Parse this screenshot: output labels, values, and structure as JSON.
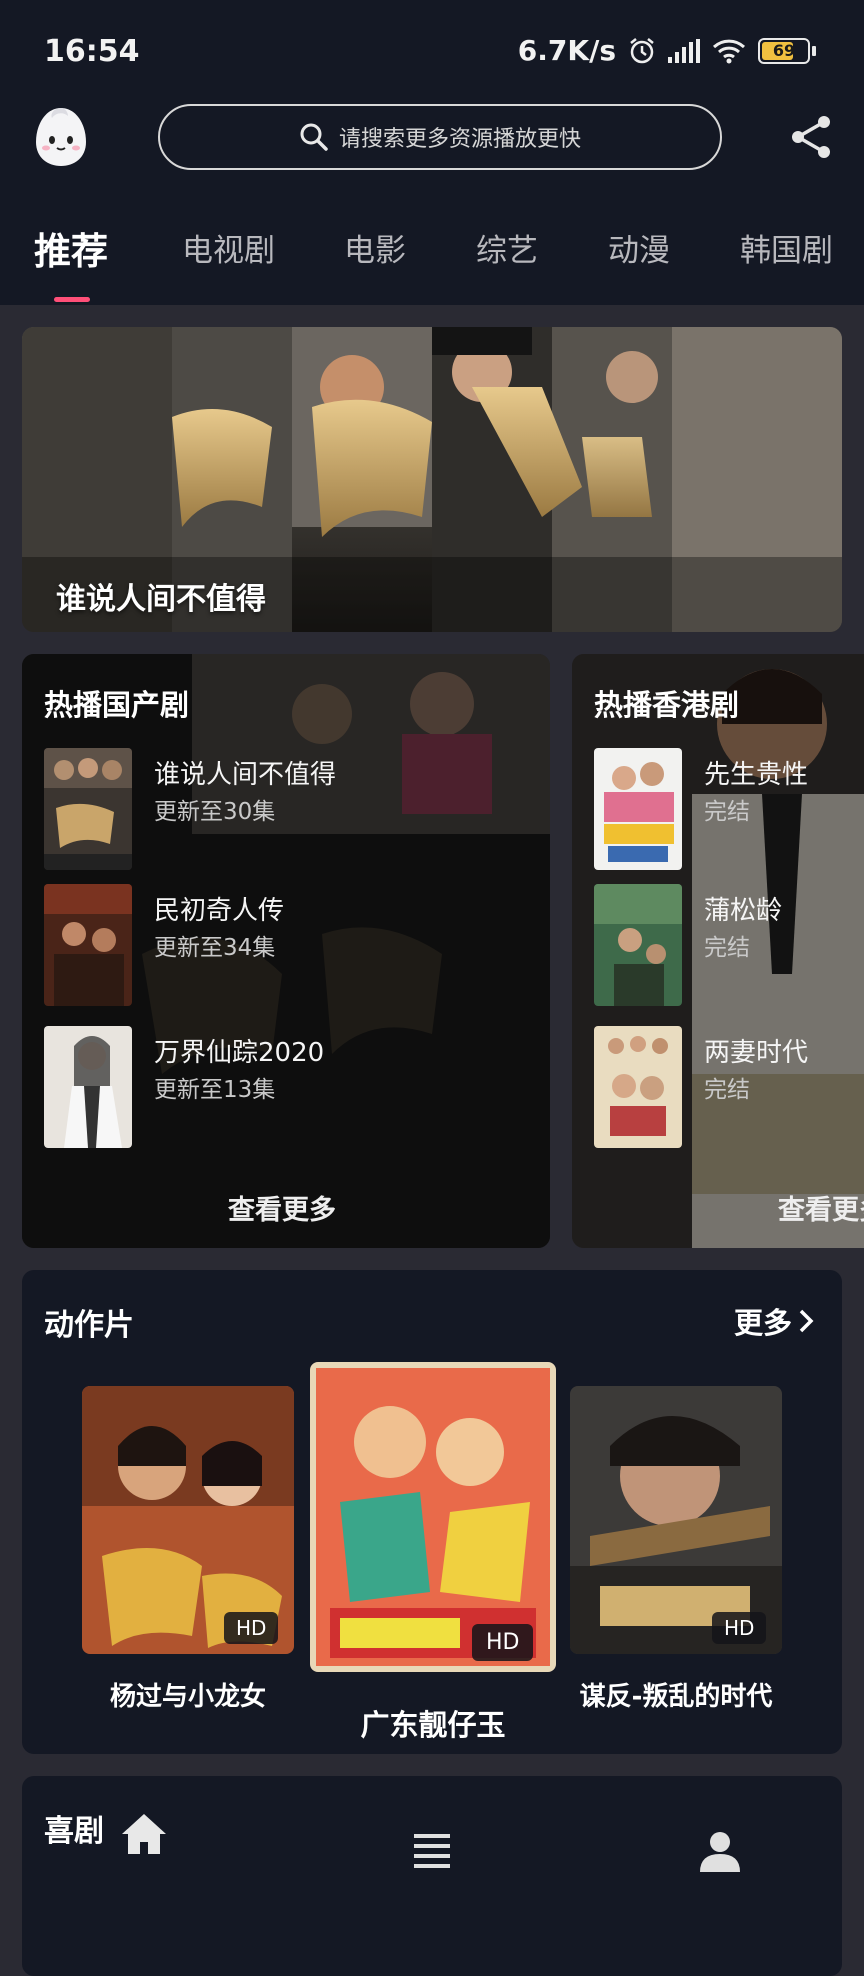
{
  "status": {
    "time": "16:54",
    "speed": "6.7K/s",
    "battery": "69"
  },
  "header": {
    "search_placeholder": "请搜索更多资源播放更快"
  },
  "tabs": [
    "推荐",
    "电视剧",
    "电影",
    "综艺",
    "动漫",
    "韩国剧"
  ],
  "banner": {
    "title": "谁说人间不值得"
  },
  "hot_domestic": {
    "title": "热播国产剧",
    "items": [
      {
        "name": "谁说人间不值得",
        "sub": "更新至30集"
      },
      {
        "name": "民初奇人传",
        "sub": "更新至34集"
      },
      {
        "name": "万界仙踪2020",
        "sub": "更新至13集"
      }
    ],
    "more": "查看更多"
  },
  "hot_hk": {
    "title": "热播香港剧",
    "items": [
      {
        "name": "先生贵性",
        "sub": "完结"
      },
      {
        "name": "蒲松龄",
        "sub": "完结"
      },
      {
        "name": "两妻时代",
        "sub": "完结"
      }
    ],
    "more": "查看更多"
  },
  "action": {
    "title": "动作片",
    "more": "更多",
    "movies": [
      {
        "name": "杨过与小龙女",
        "badge": "HD"
      },
      {
        "name": "广东靓仔玉",
        "badge": "HD"
      },
      {
        "name": "谋反-叛乱的时代",
        "badge": "HD"
      }
    ]
  },
  "next_section": {
    "title": "喜剧"
  },
  "colors": {
    "accent": "#ff4f78",
    "background": "#141824"
  }
}
